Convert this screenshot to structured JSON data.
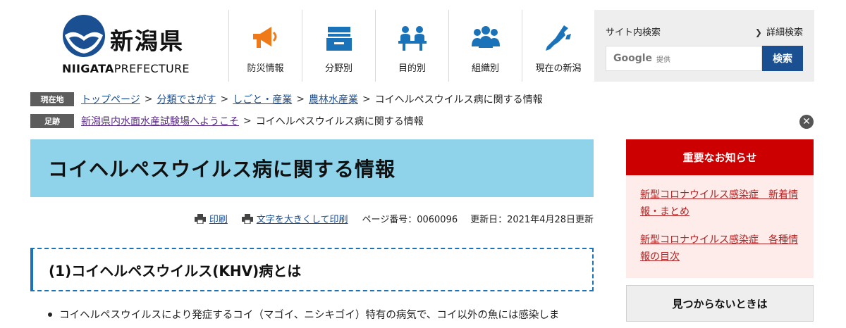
{
  "header": {
    "logo_jp": "新潟県",
    "logo_en_bold": "NIIGATA",
    "logo_en_light": "PREFECTURE",
    "nav": [
      {
        "label": "防災情報",
        "icon": "megaphone-icon"
      },
      {
        "label": "分野別",
        "icon": "file-box-icon"
      },
      {
        "label": "目的別",
        "icon": "counter-people-icon"
      },
      {
        "label": "組織別",
        "icon": "group-people-icon"
      },
      {
        "label": "現在の新潟",
        "icon": "niigata-map-icon"
      }
    ],
    "search": {
      "title": "サイト内検索",
      "advanced": "詳細検索",
      "google": "Google",
      "teikyo": "提供",
      "button": "検索"
    }
  },
  "breadcrumb": {
    "current_tag": "現在地",
    "current_items": [
      "トップページ",
      "分類でさがす",
      "しごと・産業",
      "農林水産業"
    ],
    "current_page": "コイヘルペスウイルス病に関する情報",
    "trail_tag": "足跡",
    "trail_items": [
      "新潟県内水面水産試験場へようこそ"
    ],
    "trail_page": "コイヘルペスウイルス病に関する情報",
    "separator": ">"
  },
  "main": {
    "title": "コイヘルペスウイルス病に関する情報",
    "print": "印刷",
    "print_large": "文字を大きくして印刷",
    "page_number": "ページ番号：0060096",
    "updated": "更新日：2021年4月28日更新",
    "section_title": "(1)コイヘルペスウイルス(KHV)病とは",
    "bullet": "コイヘルペスウイルスにより発症するコイ（マゴイ、ニシキゴイ）特有の病気で、コイ以外の魚には感染しま"
  },
  "sidebar": {
    "notice_title": "重要なお知らせ",
    "notice_links": [
      "新型コロナウイルス感染症　新着情報・まとめ",
      "新型コロナウイルス感染症　各種情報の目次"
    ],
    "notfound": "見つからないときは"
  },
  "colors": {
    "brand_blue": "#1a4f91",
    "nav_orange": "#f07a1a",
    "nav_blue": "#1a73b8",
    "title_banner": "#8fd3ea",
    "notice_red": "#cc0000",
    "notice_bg": "#fdecea"
  }
}
